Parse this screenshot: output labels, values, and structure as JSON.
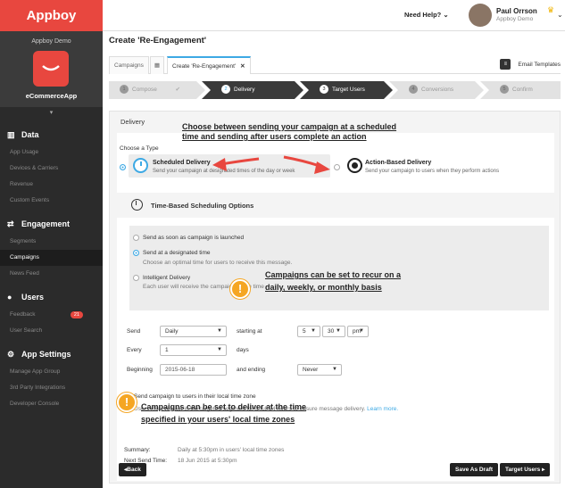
{
  "sidebar": {
    "logo": "Appboy",
    "company": "Appboy Demo",
    "app_name": "eCommerceApp",
    "collapse": "▾",
    "sections": [
      {
        "title": "Data",
        "items": [
          "App Usage",
          "Devices & Carriers",
          "Revenue",
          "Custom Events"
        ]
      },
      {
        "title": "Engagement",
        "items": [
          "Segments",
          "Campaigns",
          "News Feed"
        ]
      },
      {
        "title": "Users",
        "items": [
          "Feedback",
          "User Search"
        ],
        "feedback_badge": "21"
      },
      {
        "title": "App Settings",
        "items": [
          "Manage App Group",
          "3rd Party Integrations",
          "Developer Console"
        ]
      }
    ],
    "active_item": "Campaigns"
  },
  "header": {
    "help": "Need Help?",
    "user_name": "Paul Orrson",
    "user_org": "Appboy Demo"
  },
  "page_title": "Create 'Re-Engagement'",
  "tabs": {
    "campaigns": "Campaigns",
    "current": "Create 'Re-Engagement'",
    "email_templates": "Email Templates"
  },
  "steps": [
    {
      "num": "1",
      "label": "Compose"
    },
    {
      "num": "2",
      "label": "Delivery"
    },
    {
      "num": "3",
      "label": "Target Users"
    },
    {
      "num": "4",
      "label": "Conversions"
    },
    {
      "num": "5",
      "label": "Confirm"
    }
  ],
  "delivery": {
    "title": "Delivery",
    "choose_type": "Choose a Type",
    "scheduled_title": "Scheduled Delivery",
    "scheduled_sub": "Send your campaign at designated times of the day or week",
    "action_title": "Action-Based Delivery",
    "action_sub": "Send your campaign to users when they perform actions",
    "section_title": "Time-Based Scheduling Options",
    "opt_asap": "Send as soon as campaign is launched",
    "opt_designated": "Send at a designated time",
    "opt_designated_sub": "Choose an optimal time for users to receive this message.",
    "opt_intelligent": "Intelligent Delivery",
    "opt_intelligent_sub": "Each user will receive the campaign at the time",
    "send_label": "Send",
    "send_value": "Daily",
    "starting_at": "starting at",
    "hour": "5",
    "minute": "30",
    "ampm": "pm",
    "every_label": "Every",
    "every_value": "1",
    "days": "days",
    "beginning_label": "Beginning",
    "beginning_value": "2015-06-18",
    "ending_label": "and ending",
    "ending_value": "Never",
    "local_tz": "Send campaign to users in their local time zone",
    "local_tz_note": "Users must remain in the targeted segment for a full 24 hours to ensure message delivery.",
    "learn_more": "Learn more.",
    "summary_label": "Summary:",
    "summary_value": "Daily at 5:30pm in users' local time zones",
    "next_label": "Next Send Time:",
    "next_value": "18 Jun 2015 at 5:30pm",
    "back": "Back",
    "save_draft": "Save As Draft",
    "target_users": "Target Users"
  },
  "annotations": {
    "type_note_1": "Choose between sending your campaign at a scheduled",
    "type_note_2": "time and sending after users complete an action",
    "recur_note_1": "Campaigns can be set to recur on a",
    "recur_note_2": "daily, weekly, or monthly basis",
    "tz_note_1": "Campaigns can be set to deliver at the time",
    "tz_note_2": "specified in your users' local time zones",
    "excl": "!"
  },
  "colors": {
    "brand": "#e8473f",
    "accent": "#3da9e4",
    "annotation": "#f5a623"
  }
}
